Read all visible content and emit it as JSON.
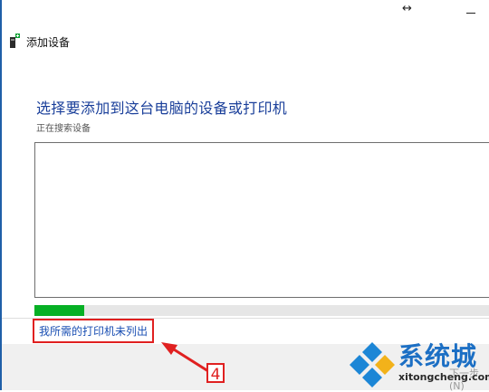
{
  "window": {
    "title": "添加设备",
    "resize_icon": "↔",
    "minimize_icon": "minimize"
  },
  "main": {
    "heading": "选择要添加到这台电脑的设备或打印机",
    "status": "正在搜索设备",
    "progress_fraction": 0.11,
    "printer_link": "我所需的打印机未列出"
  },
  "footer": {
    "next_label": "下一步(N)"
  },
  "annotation": {
    "step_number": "4",
    "color": "#e02020"
  },
  "watermark": {
    "title": "系统城",
    "domain": "xitongcheng.com"
  },
  "colors": {
    "accent": "#1a3f9a",
    "progress": "#06b025",
    "link": "#1a4fb3"
  }
}
